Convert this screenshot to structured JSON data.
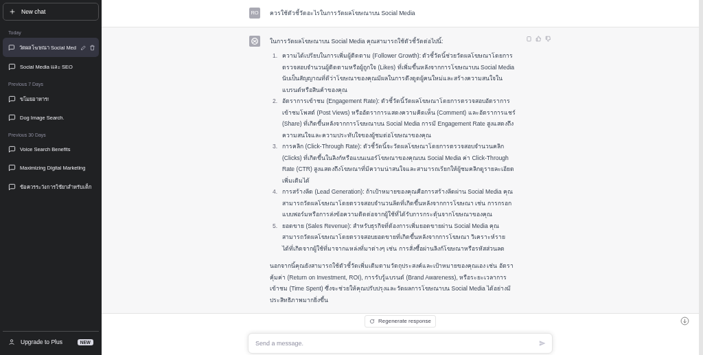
{
  "sidebar": {
    "new_chat": "New chat",
    "groups": [
      {
        "label": "Today",
        "items": [
          {
            "title": "วัดผลโฆษณา Social Med",
            "selected": true
          },
          {
            "title": "Social Media และ SEO",
            "selected": false
          }
        ]
      },
      {
        "label": "Previous 7 Days",
        "items": [
          {
            "title": "ขโมยอาหาร!",
            "selected": false
          },
          {
            "title": "Dog Image Search.",
            "selected": false
          }
        ]
      },
      {
        "label": "Previous 30 Days",
        "items": [
          {
            "title": "Voice Search Benefits",
            "selected": false
          },
          {
            "title": "Maximizing Digital Marketing",
            "selected": false
          },
          {
            "title": "ข้อควรระวังการใช้ยาสำหรับเด็ก",
            "selected": false
          }
        ]
      }
    ],
    "upgrade": "Upgrade to Plus",
    "badge": "NEW"
  },
  "messages": [
    {
      "kind": "user",
      "avatar": "RO",
      "text": "ควรใช้ตัวชี้วัดอะไรในการวัดผลโฆษณาบน Social Media"
    },
    {
      "kind": "assistant",
      "intro": "ในการวัดผลโฆษณาบน Social Media คุณสามารถใช้ตัวชี้วัดต่อไปนี้:",
      "list": [
        {
          "number": "1.",
          "text": "ความได้เปรียบในการเพิ่มผู้ติดตาม (Follower Growth): ตัวชี้วัดนี้ช่วยวัดผลโฆษณาโดยการตรวจสอบจำนวนผู้ติดตามหรือผู้ถูกใจ (Likes) ที่เพิ่มขึ้นหลังจากการโฆษณาบน Social Media นับเป็นสัญญาณที่ดีว่าโฆษณาของคุณมีผลในการดึงดูดผู้คนใหม่และสร้างความสนใจในแบรนด์หรือสินค้าของคุณ"
        },
        {
          "number": "2.",
          "text": "อัตราการเข้าชม (Engagement Rate): ตัวชี้วัดนี้วัดผลโฆษณาโดยการตรวจสอบอัตราการเข้าชมโพสต์ (Post Views) หรืออัตราการแสดงความคิดเห็น (Comment) และอัตราการแชร์ (Share) ที่เกิดขึ้นหลังจากการโฆษณาบน Social Media การมี Engagement Rate สูงแสดงถึงความสนใจและความประทับใจของผู้ชมต่อโฆษณาของคุณ"
        },
        {
          "number": "3.",
          "text": "การคลิก (Click-Through Rate): ตัวชี้วัดนี้จะวัดผลโฆษณาโดยการตรวจสอบจำนวนคลิก (Clicks) ที่เกิดขึ้นในลิงก์หรือแบนเนอร์โฆษณาของคุณบน Social Media ค่า Click-Through Rate (CTR) สูงแสดงถึงโฆษณาที่มีความน่าสนใจและสามารถเรียกให้ผู้ชมคลิกดูรายละเอียดเพิ่มเติมได้"
        },
        {
          "number": "4.",
          "text": "การสร้างลีด (Lead Generation): ถ้าเป้าหมายของคุณคือการสร้างลีดผ่าน Social Media คุณสามารถวัดผลโฆษณาโดยตรวจสอบจำนวนลีดที่เกิดขึ้นหลังจากการโฆษณา เช่น การกรอกแบบฟอร์มหรือการส่งข้อความติดต่อจากผู้ใช้ที่ได้รับการกระตุ้นจากโฆษณาของคุณ"
        },
        {
          "number": "5.",
          "text": "ยอดขาย (Sales Revenue): สำหรับธุรกิจที่ต้องการเพิ่มยอดขายผ่าน Social Media คุณสามารถวัดผลโฆษณาโดยตรวจสอบยอดขายที่เกิดขึ้นหลังจากการโฆษณา วิเคราะห์รายได้ที่เกิดจากผู้ใช้ที่มาจากแหล่งที่มาต่างๆ เช่น การสั่งซื้อผ่านลิงก์โฆษณาหรือรหัสส่วนลด"
        }
      ],
      "outro": "นอกจากนี้คุณยังสามารถใช้ตัวชี้วัดเพิ่มเติมตามวัตถุประสงค์และเป้าหมายของคุณเอง เช่น อัตราคุ้มค่า (Return on Investment, ROI), การรับรู้แบรนด์ (Brand Awareness), หรือระยะเวลาการเข้าชม (Time Spent) ซึ่งจะช่วยให้คุณปรับปรุงและวัดผลการโฆษณาบน Social Media ได้อย่างมีประสิทธิภาพมากยิ่งขึ้น"
    }
  ],
  "regenerate": "Regenerate response",
  "composer": {
    "placeholder": "Send a message."
  }
}
